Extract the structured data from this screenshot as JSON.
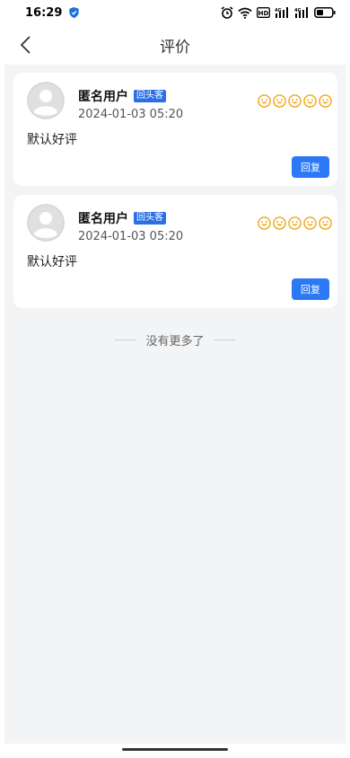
{
  "status_bar": {
    "time": "16:29",
    "icons": [
      "shield-icon",
      "alarm-icon",
      "wifi-icon",
      "hd-icon",
      "signal-icon",
      "signal-icon",
      "battery-icon"
    ]
  },
  "header": {
    "title": "评价",
    "back_icon": "chevron-left-icon"
  },
  "reviews": [
    {
      "user_name": "匿名用户",
      "badge": "回头客",
      "date": "2024-01-03 05:20",
      "rating": 5,
      "rating_icon": "smiley-icon",
      "content": "默认好评",
      "reply_label": "回复"
    },
    {
      "user_name": "匿名用户",
      "badge": "回头客",
      "date": "2024-01-03 05:20",
      "rating": 5,
      "rating_icon": "smiley-icon",
      "content": "默认好评",
      "reply_label": "回复"
    }
  ],
  "list_end_text": "没有更多了",
  "colors": {
    "accent": "#2b79f5",
    "badge": "#2b6fe6",
    "rating": "#f0a616",
    "background": "#f3f4f6"
  }
}
